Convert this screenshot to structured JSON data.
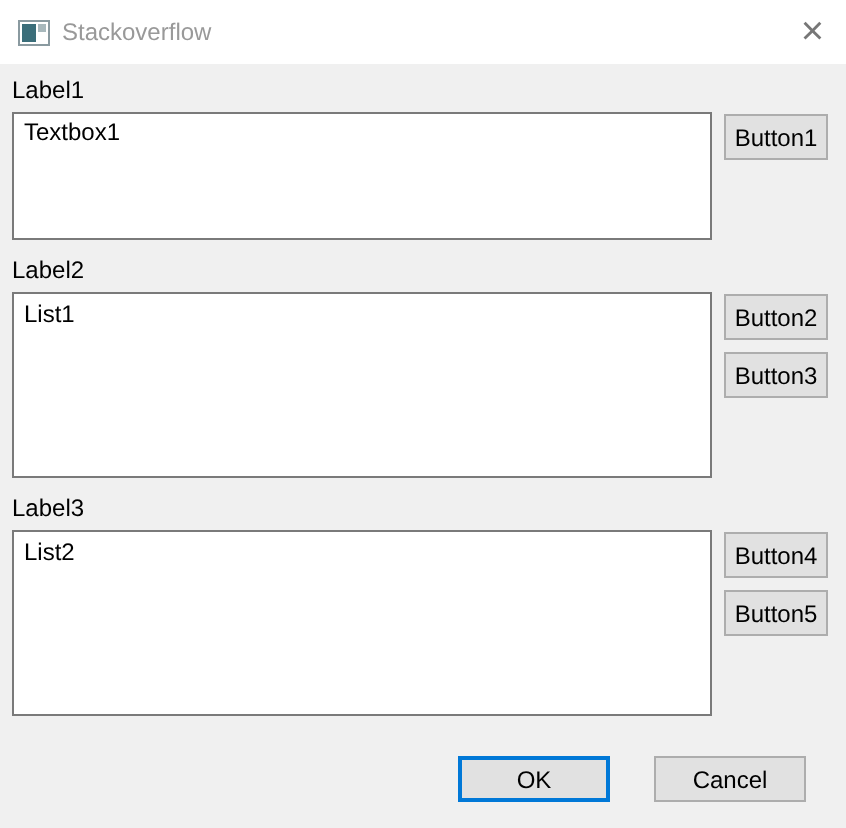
{
  "window": {
    "title": "Stackoverflow",
    "close": "×"
  },
  "sections": [
    {
      "label": "Label1",
      "kind": "textbox",
      "value": "Textbox1",
      "buttons": [
        "Button1"
      ]
    },
    {
      "label": "Label2",
      "kind": "list",
      "items": [
        "List1"
      ],
      "buttons": [
        "Button2",
        "Button3"
      ]
    },
    {
      "label": "Label3",
      "kind": "list",
      "items": [
        "List2"
      ],
      "buttons": [
        "Button4",
        "Button5"
      ]
    }
  ],
  "footer": [
    {
      "label": "OK",
      "default": true
    },
    {
      "label": "Cancel",
      "default": false
    }
  ]
}
